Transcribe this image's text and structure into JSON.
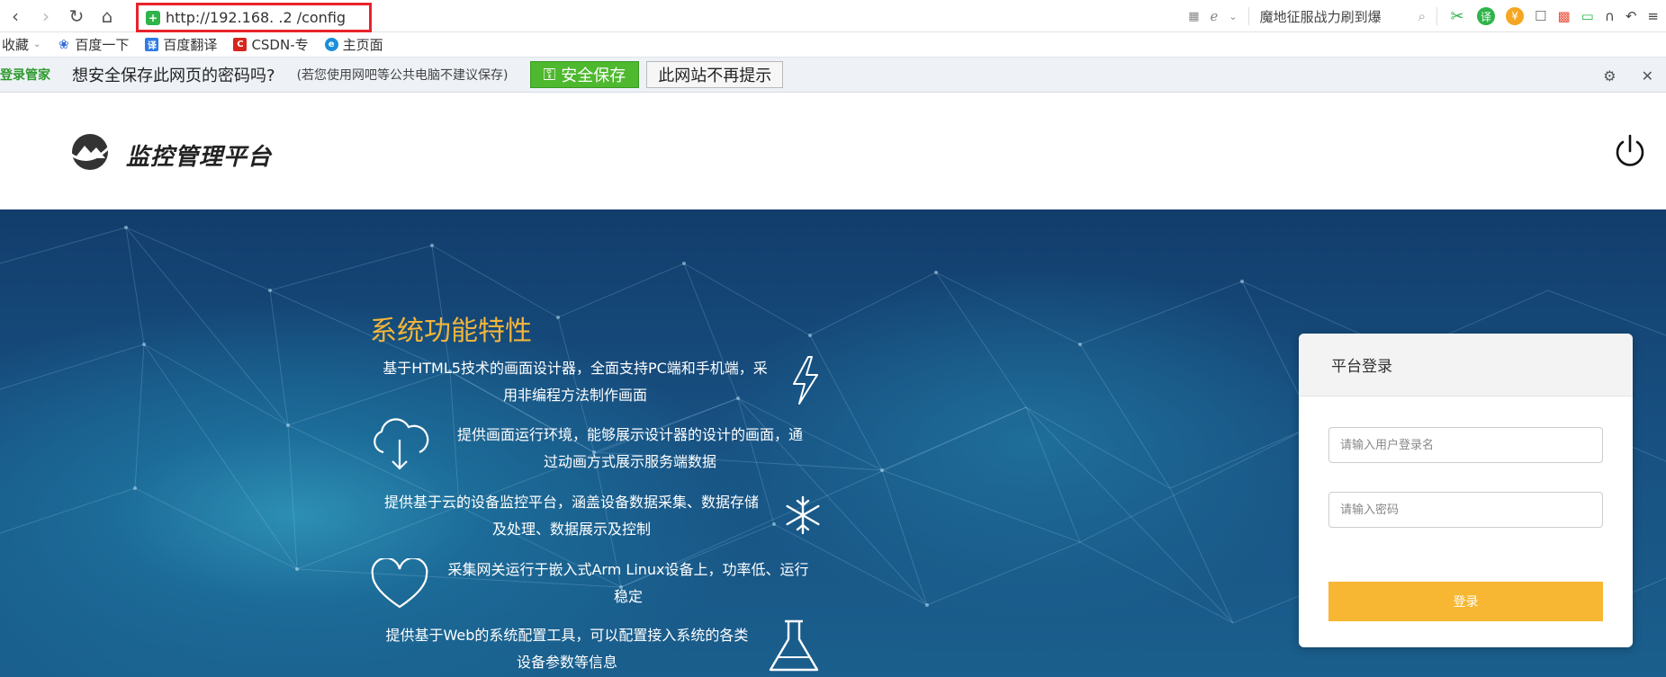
{
  "browser": {
    "url": "http://192.168.  .2  /config",
    "search_text": "魔地征服战力刷到爆",
    "bookmarks": [
      {
        "label": "收藏",
        "icon": "chevron-down-icon"
      },
      {
        "label": "百度一下",
        "icon": "baidu-paw-icon"
      },
      {
        "label": "百度翻译",
        "icon": "translate-icon"
      },
      {
        "label": "CSDN-专",
        "icon": "csdn-icon"
      },
      {
        "label": "主页面",
        "icon": "ie-icon"
      }
    ]
  },
  "password_bar": {
    "brand": "登录管家",
    "question": "想安全保存此网页的密码吗?",
    "note": "(若您使用网吧等公共电脑不建议保存)",
    "save_label": "安全保存",
    "never_label": "此网站不再提示"
  },
  "site": {
    "title": "监控管理平台"
  },
  "features": {
    "title": "系统功能特性",
    "items": [
      {
        "line1": "基于HTML5技术的画面设计器，全面支持PC端和手机端，采",
        "line2": "用非编程方法制作画面",
        "icon": "lightning-icon"
      },
      {
        "line1": "提供画面运行环境，能够展示设计器的设计的画面，通",
        "line2": "过动画方式展示服务端数据",
        "icon": "cloud-download-icon"
      },
      {
        "line1": "提供基于云的设备监控平台，涵盖设备数据采集、数据存储",
        "line2": "及处理、数据展示及控制",
        "icon": "snowflake-icon"
      },
      {
        "line1": "采集网关运行于嵌入式Arm Linux设备上，功率低、运行",
        "line2": "稳定",
        "icon": "heart-icon"
      },
      {
        "line1": "提供基于Web的系统配置工具，可以配置接入系统的各类",
        "line2": "设备参数等信息",
        "icon": "flask-icon"
      }
    ]
  },
  "login": {
    "title": "平台登录",
    "username_placeholder": "请输入用户登录名",
    "password_placeholder": "请输入密码",
    "submit_label": "登录"
  },
  "colors": {
    "accent_gold": "#f2b53a",
    "button_yellow": "#f7b733",
    "save_green": "#4eb82e",
    "highlight_red": "#e8232a"
  }
}
